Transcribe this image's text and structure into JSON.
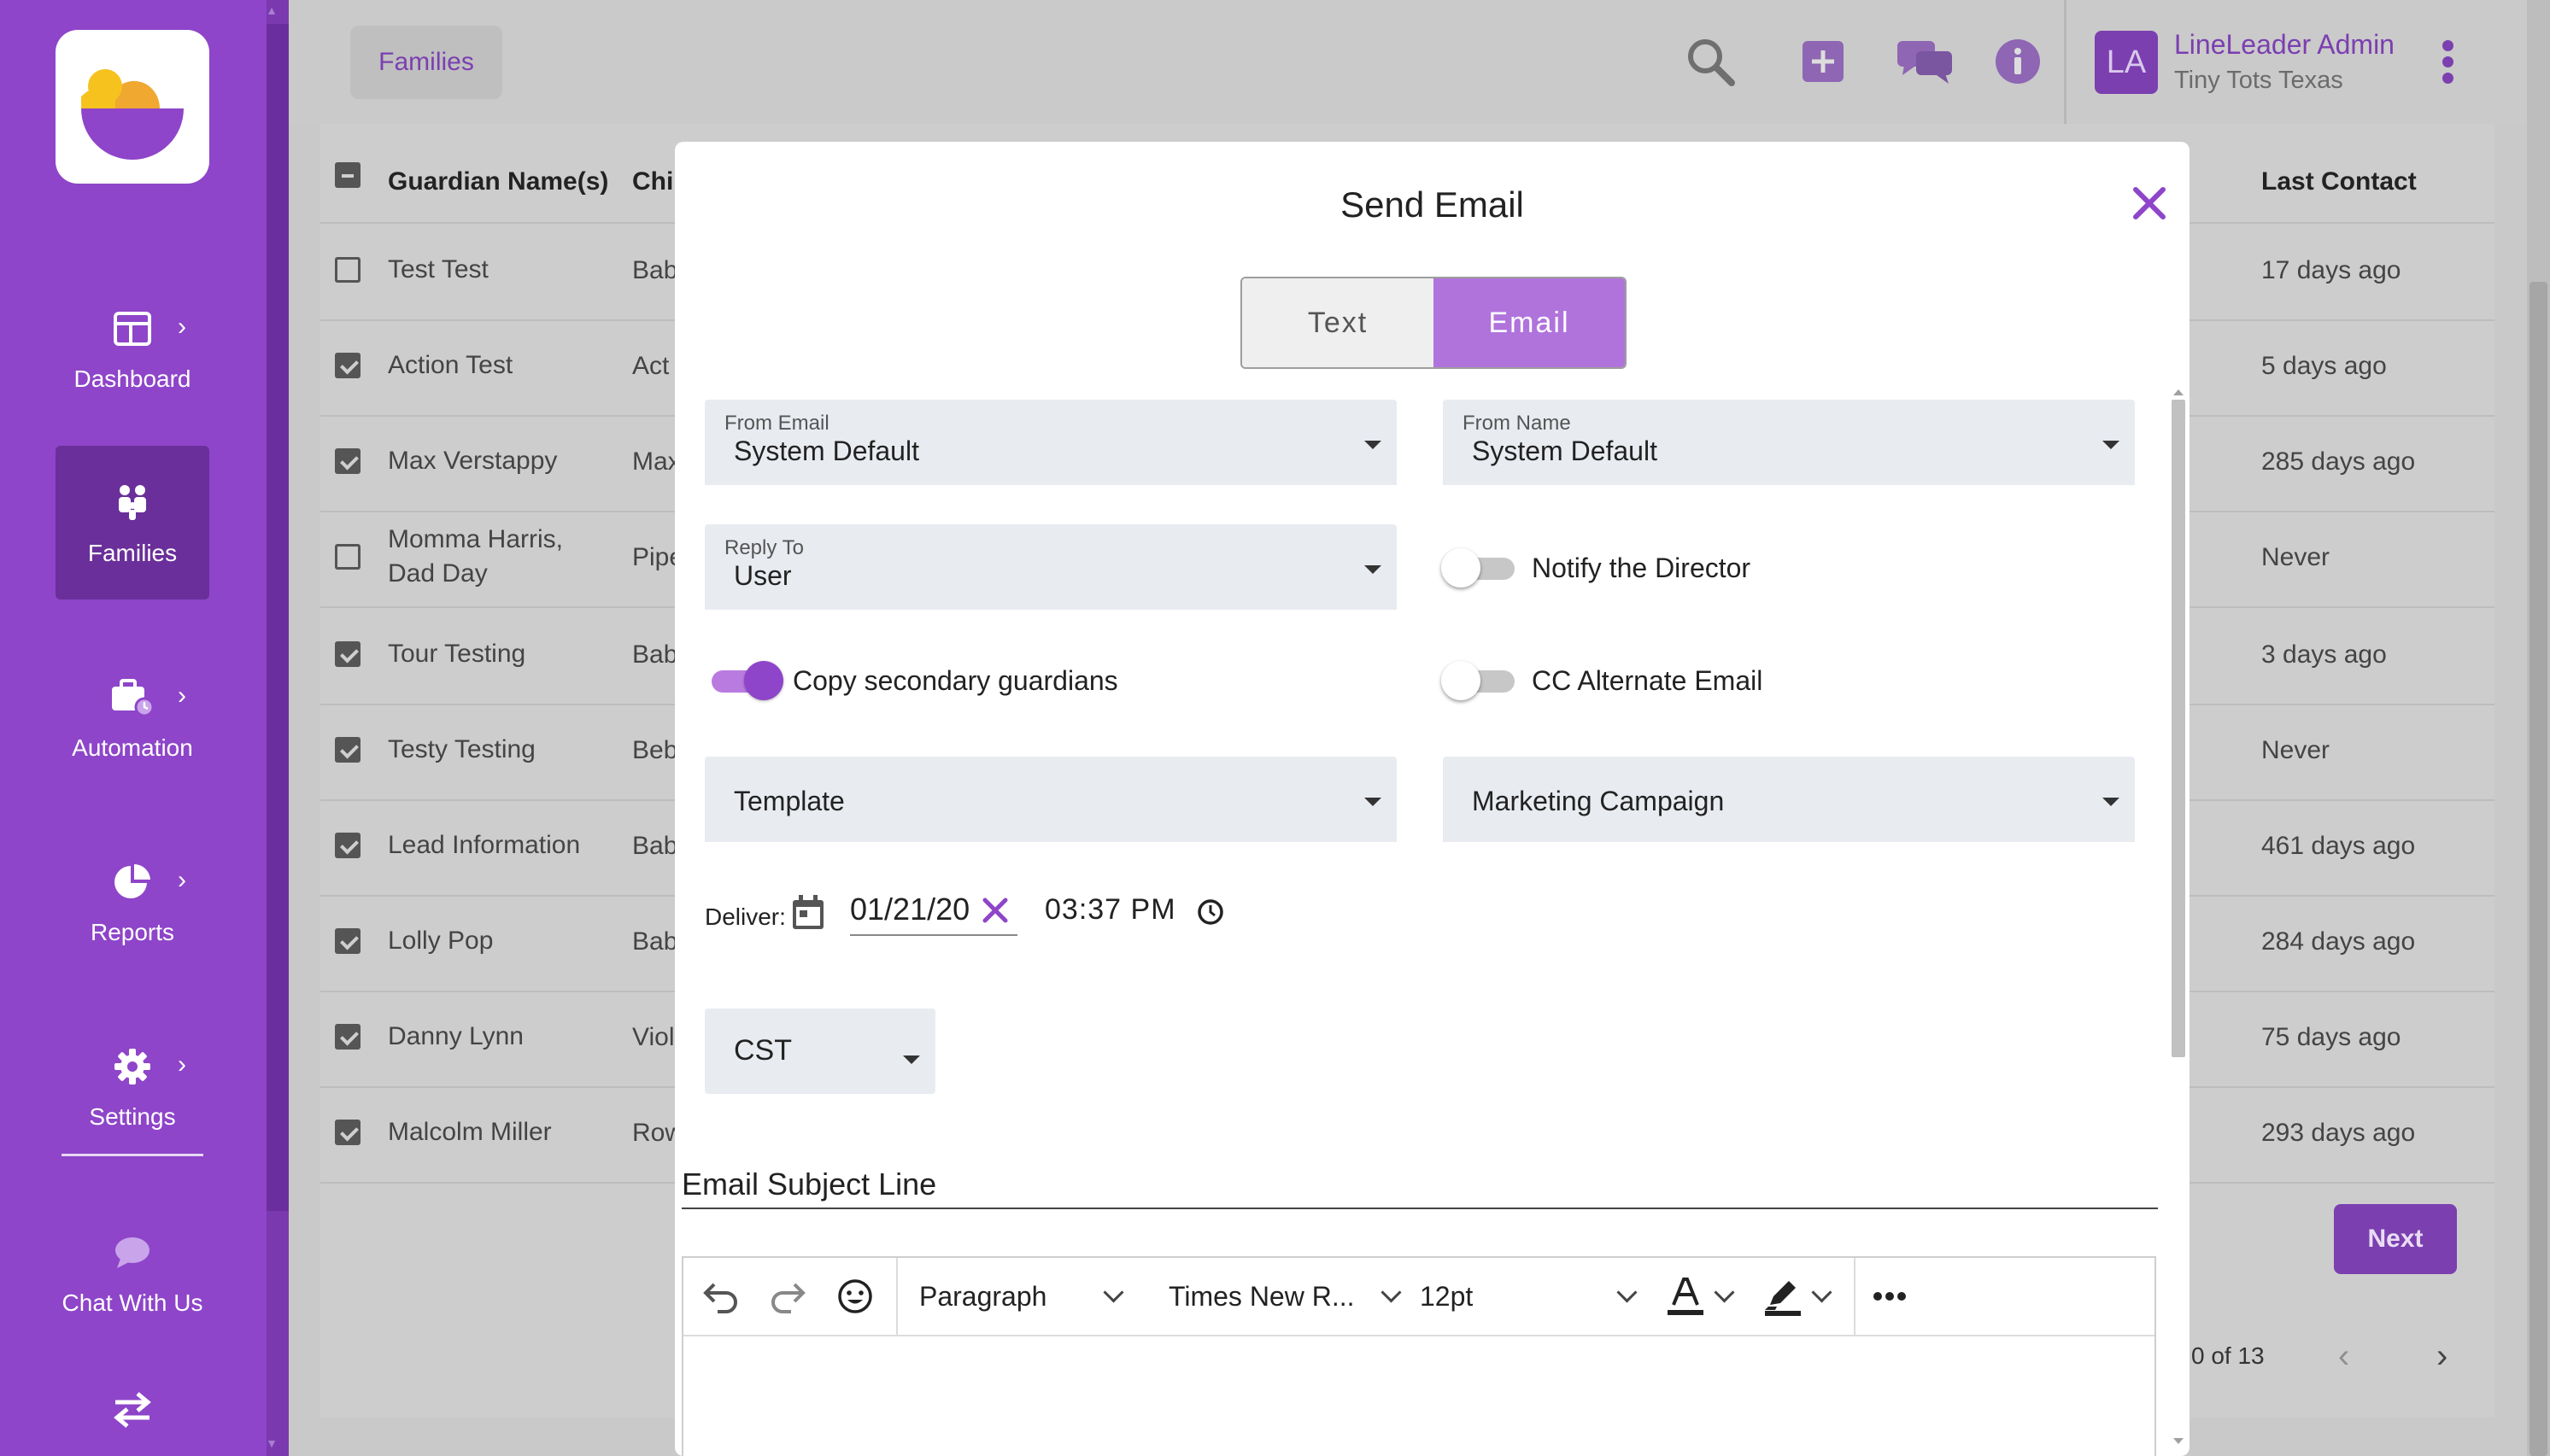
{
  "app": {
    "user": {
      "initials": "LA",
      "name": "LineLeader Admin",
      "org": "Tiny Tots Texas"
    },
    "breadcrumb": "Families"
  },
  "sidebar": {
    "items": [
      {
        "label": "Dashboard",
        "icon": "dashboard-icon"
      },
      {
        "label": "Families",
        "icon": "families-icon"
      },
      {
        "label": "Automation",
        "icon": "automation-icon"
      },
      {
        "label": "Reports",
        "icon": "reports-icon"
      },
      {
        "label": "Settings",
        "icon": "settings-icon"
      },
      {
        "label": "Chat With Us",
        "icon": "chat-icon"
      },
      {
        "label": "",
        "icon": "switch-icon"
      }
    ]
  },
  "table": {
    "headers": {
      "guardian": "Guardian Name(s)",
      "child": "Chi",
      "last_contact": "Last Contact"
    },
    "rows": [
      {
        "guardian": "Test Test",
        "child": "Bab",
        "last_contact": "17 days ago",
        "checked": false
      },
      {
        "guardian": "Action Test",
        "child": "Act",
        "last_contact": "5 days ago",
        "checked": true
      },
      {
        "guardian": "Max Verstappy",
        "child": "Max",
        "last_contact": "285 days ago",
        "checked": true
      },
      {
        "guardian": "Momma Harris,",
        "guardian2": "Dad Day",
        "child": "Pipe",
        "last_contact": "Never",
        "checked": false
      },
      {
        "guardian": "Tour Testing",
        "child": "Bab",
        "last_contact": "3 days ago",
        "checked": true
      },
      {
        "guardian": "Testy Testing",
        "child": "Beb",
        "last_contact": "Never",
        "checked": true
      },
      {
        "guardian": "Lead Information",
        "child": "Bab",
        "last_contact": "461 days ago",
        "checked": true
      },
      {
        "guardian": "Lolly Pop",
        "child": "Bab",
        "last_contact": "284 days ago",
        "checked": true
      },
      {
        "guardian": "Danny Lynn",
        "child": "Viol",
        "last_contact": "75 days ago",
        "checked": true
      },
      {
        "guardian": "Malcolm Miller",
        "child": "Row",
        "last_contact": "293 days ago",
        "checked": true
      }
    ],
    "next_label": "Next",
    "pager_text": "0 of 13"
  },
  "modal": {
    "title": "Send Email",
    "tabs": {
      "text": "Text",
      "email": "Email",
      "active": "Email"
    },
    "from_email": {
      "label": "From Email",
      "value": "System Default"
    },
    "from_name": {
      "label": "From Name",
      "value": "System Default"
    },
    "reply_to": {
      "label": "Reply To",
      "value": "User"
    },
    "notify_director": {
      "label": "Notify the Director",
      "on": false
    },
    "copy_secondary": {
      "label": "Copy secondary guardians",
      "on": true
    },
    "cc_alternate": {
      "label": "CC Alternate Email",
      "on": false
    },
    "template": {
      "value": "Template"
    },
    "campaign": {
      "value": "Marketing Campaign"
    },
    "deliver": {
      "label": "Deliver:",
      "date": "01/21/20",
      "time": "03:37 PM"
    },
    "timezone": "CST",
    "subject_placeholder": "Email Subject Line",
    "editor": {
      "block": "Paragraph",
      "font": "Times New R...",
      "size": "12pt"
    }
  },
  "colors": {
    "brand": "#8e45c9",
    "brand_dark": "#7b3fb0",
    "toggle_on": "#8e45c9"
  }
}
